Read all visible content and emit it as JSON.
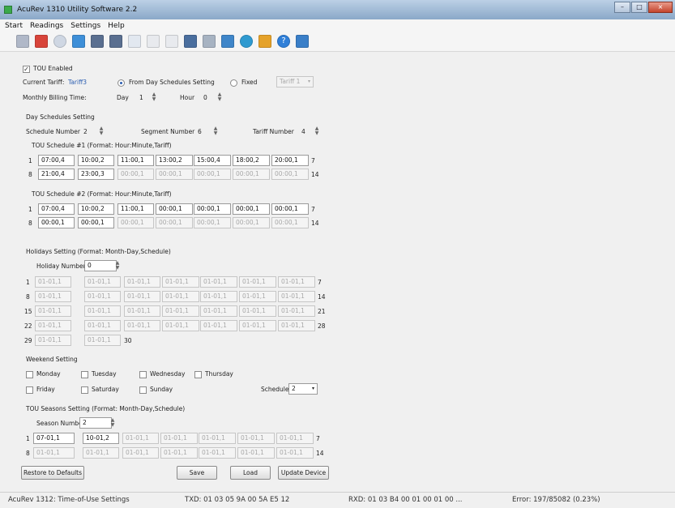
{
  "window": {
    "title": "AcuRev 1310 Utility Software 2.2",
    "minimize": "–",
    "maximize": "□",
    "close": "×"
  },
  "menu": [
    "Start",
    "Readings",
    "Settings",
    "Help"
  ],
  "toolbar_icons": [
    "connect",
    "disconnect",
    "refresh",
    "readings",
    "meter-a",
    "meter-b",
    "report",
    "calendar-a",
    "calendar-b",
    "device",
    "tools",
    "timer",
    "clock",
    "export",
    "help",
    "exit"
  ],
  "tou": {
    "enabled_label": "TOU Enabled",
    "current_tariff_label": "Current Tariff:",
    "current_tariff_value": "Tariff3",
    "from_day_label": "From Day Schedules Setting",
    "fixed_label": "Fixed",
    "fixed_select": "Tariff 1",
    "billing_label": "Monthly Billing Time:",
    "day_label": "Day",
    "day_value": "1",
    "hour_label": "Hour",
    "hour_value": "0"
  },
  "day_schedules": {
    "heading": "Day Schedules Setting",
    "schedule_number_label": "Schedule Number",
    "schedule_number": "2",
    "segment_number_label": "Segment Number",
    "segment_number": "6",
    "tariff_number_label": "Tariff Number",
    "tariff_number": "4",
    "schedules": [
      {
        "title": "TOU Schedule #1 (Format: Hour:Minute,Tariff)",
        "row1_start": "1",
        "row1_end": "7",
        "row2_start": "8",
        "row2_end": "14",
        "row1": [
          "07:00,4",
          "10:00,2",
          "11:00,1",
          "13:00,2",
          "15:00,4",
          "18:00,2",
          "20:00,1"
        ],
        "row2": [
          "21:00,4",
          "23:00,3",
          "00:00,1",
          "00:00,1",
          "00:00,1",
          "00:00,1",
          "00:00,1"
        ]
      },
      {
        "title": "TOU Schedule #2 (Format: Hour:Minute,Tariff)",
        "row1_start": "1",
        "row1_end": "7",
        "row2_start": "8",
        "row2_end": "14",
        "row1": [
          "07:00,4",
          "10:00,2",
          "11:00,1",
          "00:00,1",
          "00:00,1",
          "00:00,1",
          "00:00,1"
        ],
        "row2": [
          "00:00,1",
          "00:00,1",
          "00:00,1",
          "00:00,1",
          "00:00,1",
          "00:00,1",
          "00:00,1"
        ]
      }
    ]
  },
  "holidays": {
    "heading": "Holidays Setting (Format: Month-Day,Schedule)",
    "number_label": "Holiday Number",
    "number": "0",
    "rows": [
      {
        "start": "1",
        "end": "7",
        "values": [
          "01-01,1",
          "01-01,1",
          "01-01,1",
          "01-01,1",
          "01-01,1",
          "01-01,1",
          "01-01,1"
        ]
      },
      {
        "start": "8",
        "end": "14",
        "values": [
          "01-01,1",
          "01-01,1",
          "01-01,1",
          "01-01,1",
          "01-01,1",
          "01-01,1",
          "01-01,1"
        ]
      },
      {
        "start": "15",
        "end": "21",
        "values": [
          "01-01,1",
          "01-01,1",
          "01-01,1",
          "01-01,1",
          "01-01,1",
          "01-01,1",
          "01-01,1"
        ]
      },
      {
        "start": "22",
        "end": "28",
        "values": [
          "01-01,1",
          "01-01,1",
          "01-01,1",
          "01-01,1",
          "01-01,1",
          "01-01,1",
          "01-01,1"
        ]
      },
      {
        "start": "29",
        "end": "30",
        "values": [
          "01-01,1",
          "01-01,1"
        ]
      }
    ]
  },
  "weekend": {
    "heading": "Weekend Setting",
    "days": [
      "Monday",
      "Tuesday",
      "Wednesday",
      "Thursday",
      "Friday",
      "Saturday",
      "Sunday"
    ],
    "schedule_label": "Schedule",
    "schedule_value": "2"
  },
  "seasons": {
    "heading": "TOU Seasons Setting (Format: Month-Day,Schedule)",
    "number_label": "Season Number",
    "number": "2",
    "row1_start": "1",
    "row1_end": "7",
    "row2_start": "8",
    "row2_end": "14",
    "row1": [
      "07-01,1",
      "10-01,2",
      "01-01,1",
      "01-01,1",
      "01-01,1",
      "01-01,1",
      "01-01,1"
    ],
    "row2": [
      "01-01,1",
      "01-01,1",
      "01-01,1",
      "01-01,1",
      "01-01,1",
      "01-01,1",
      "01-01,1"
    ]
  },
  "buttons": {
    "restore": "Restore to Defaults",
    "save": "Save",
    "load": "Load",
    "update": "Update Device"
  },
  "status": {
    "left": "AcuRev 1312: Time-of-Use Settings",
    "txd": "TXD: 01 03 05 9A 00 5A E5 12",
    "rxd": "RXD: 01 03 B4 00 01 00 01 00 ...",
    "error": "Error: 197/85082 (0.23%)"
  },
  "colors": {
    "accent": "#2a5db0",
    "title_gradient_top": "#bcd0e6"
  }
}
